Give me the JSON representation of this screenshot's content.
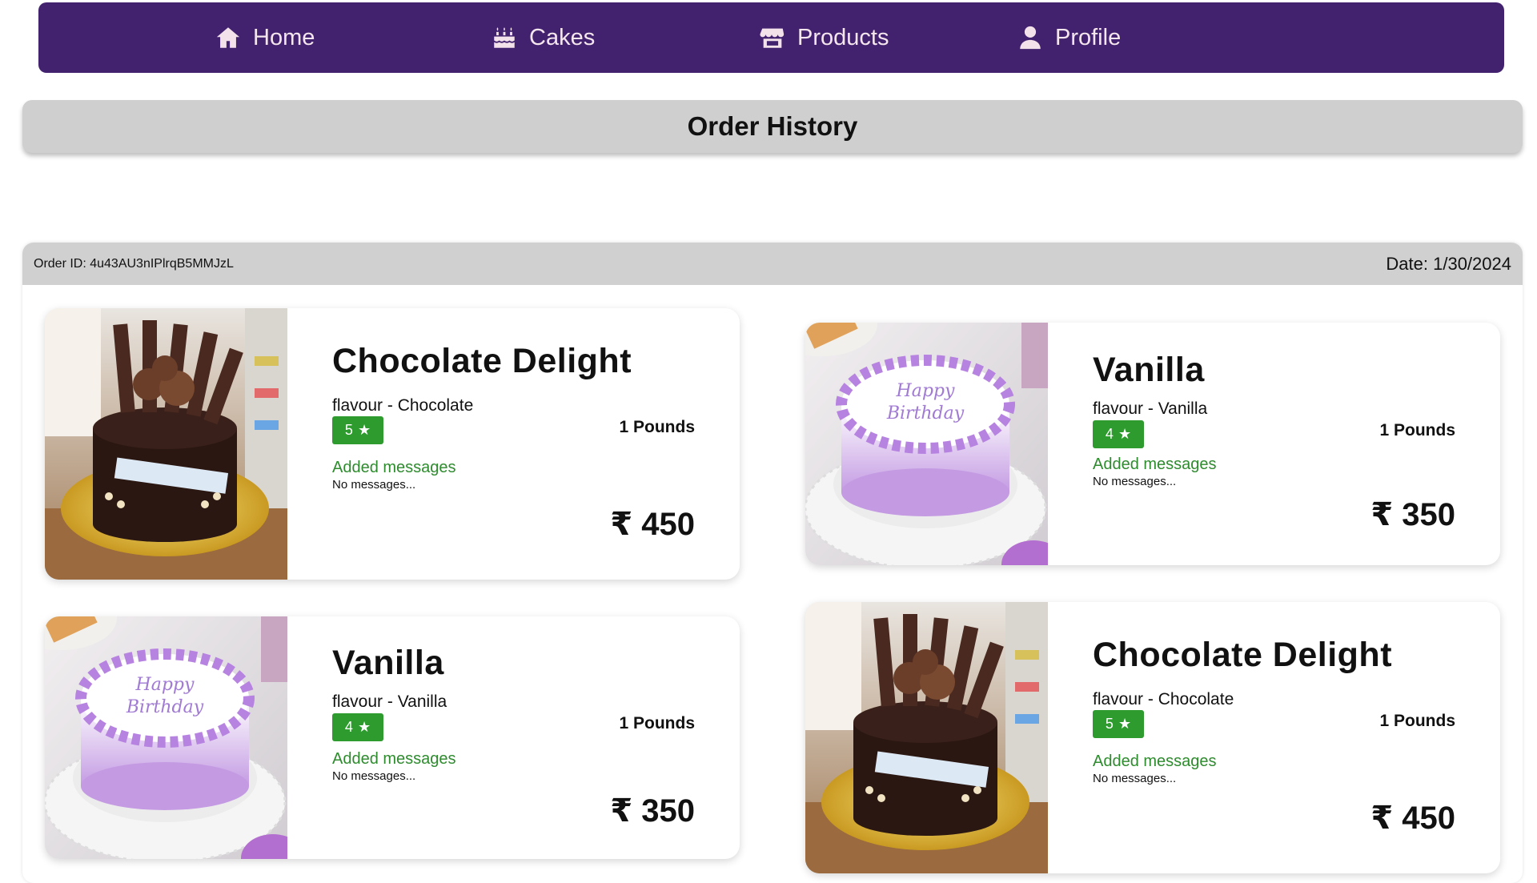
{
  "nav": {
    "items": [
      {
        "label": "Home",
        "icon": "home-icon"
      },
      {
        "label": "Cakes",
        "icon": "cake-icon"
      },
      {
        "label": "Products",
        "icon": "store-icon"
      },
      {
        "label": "Profile",
        "icon": "user-icon"
      }
    ]
  },
  "page": {
    "title": "Order History"
  },
  "order": {
    "id_label": "Order ID: 4u43AU3nIPlrqB5MMJzL",
    "date_label": "Date: 1/30/2024",
    "items": [
      {
        "name": "Chocolate Delight",
        "flavour": "flavour - Chocolate",
        "rating": "5",
        "weight": "1 Pounds",
        "added_label": "Added messages",
        "messages": "No messages...",
        "price": "₹ 450",
        "image": "chocolate-cake"
      },
      {
        "name": "Vanilla",
        "flavour": "flavour - Vanilla",
        "rating": "4",
        "weight": "1 Pounds",
        "added_label": "Added messages",
        "messages": "No messages...",
        "price": "₹ 350",
        "image": "vanilla-cake"
      },
      {
        "name": "Vanilla",
        "flavour": "flavour - Vanilla",
        "rating": "4",
        "weight": "1 Pounds",
        "added_label": "Added messages",
        "messages": "No messages...",
        "price": "₹ 350",
        "image": "vanilla-cake"
      },
      {
        "name": "Chocolate Delight",
        "flavour": "flavour - Chocolate",
        "rating": "5",
        "weight": "1 Pounds",
        "added_label": "Added messages",
        "messages": "No messages...",
        "price": "₹ 450",
        "image": "chocolate-cake"
      }
    ]
  },
  "colors": {
    "nav_bg": "#42226f",
    "header_bg": "#cfcfcf",
    "rating_green": "#2e9b2e",
    "message_green": "#2e8b2e"
  }
}
